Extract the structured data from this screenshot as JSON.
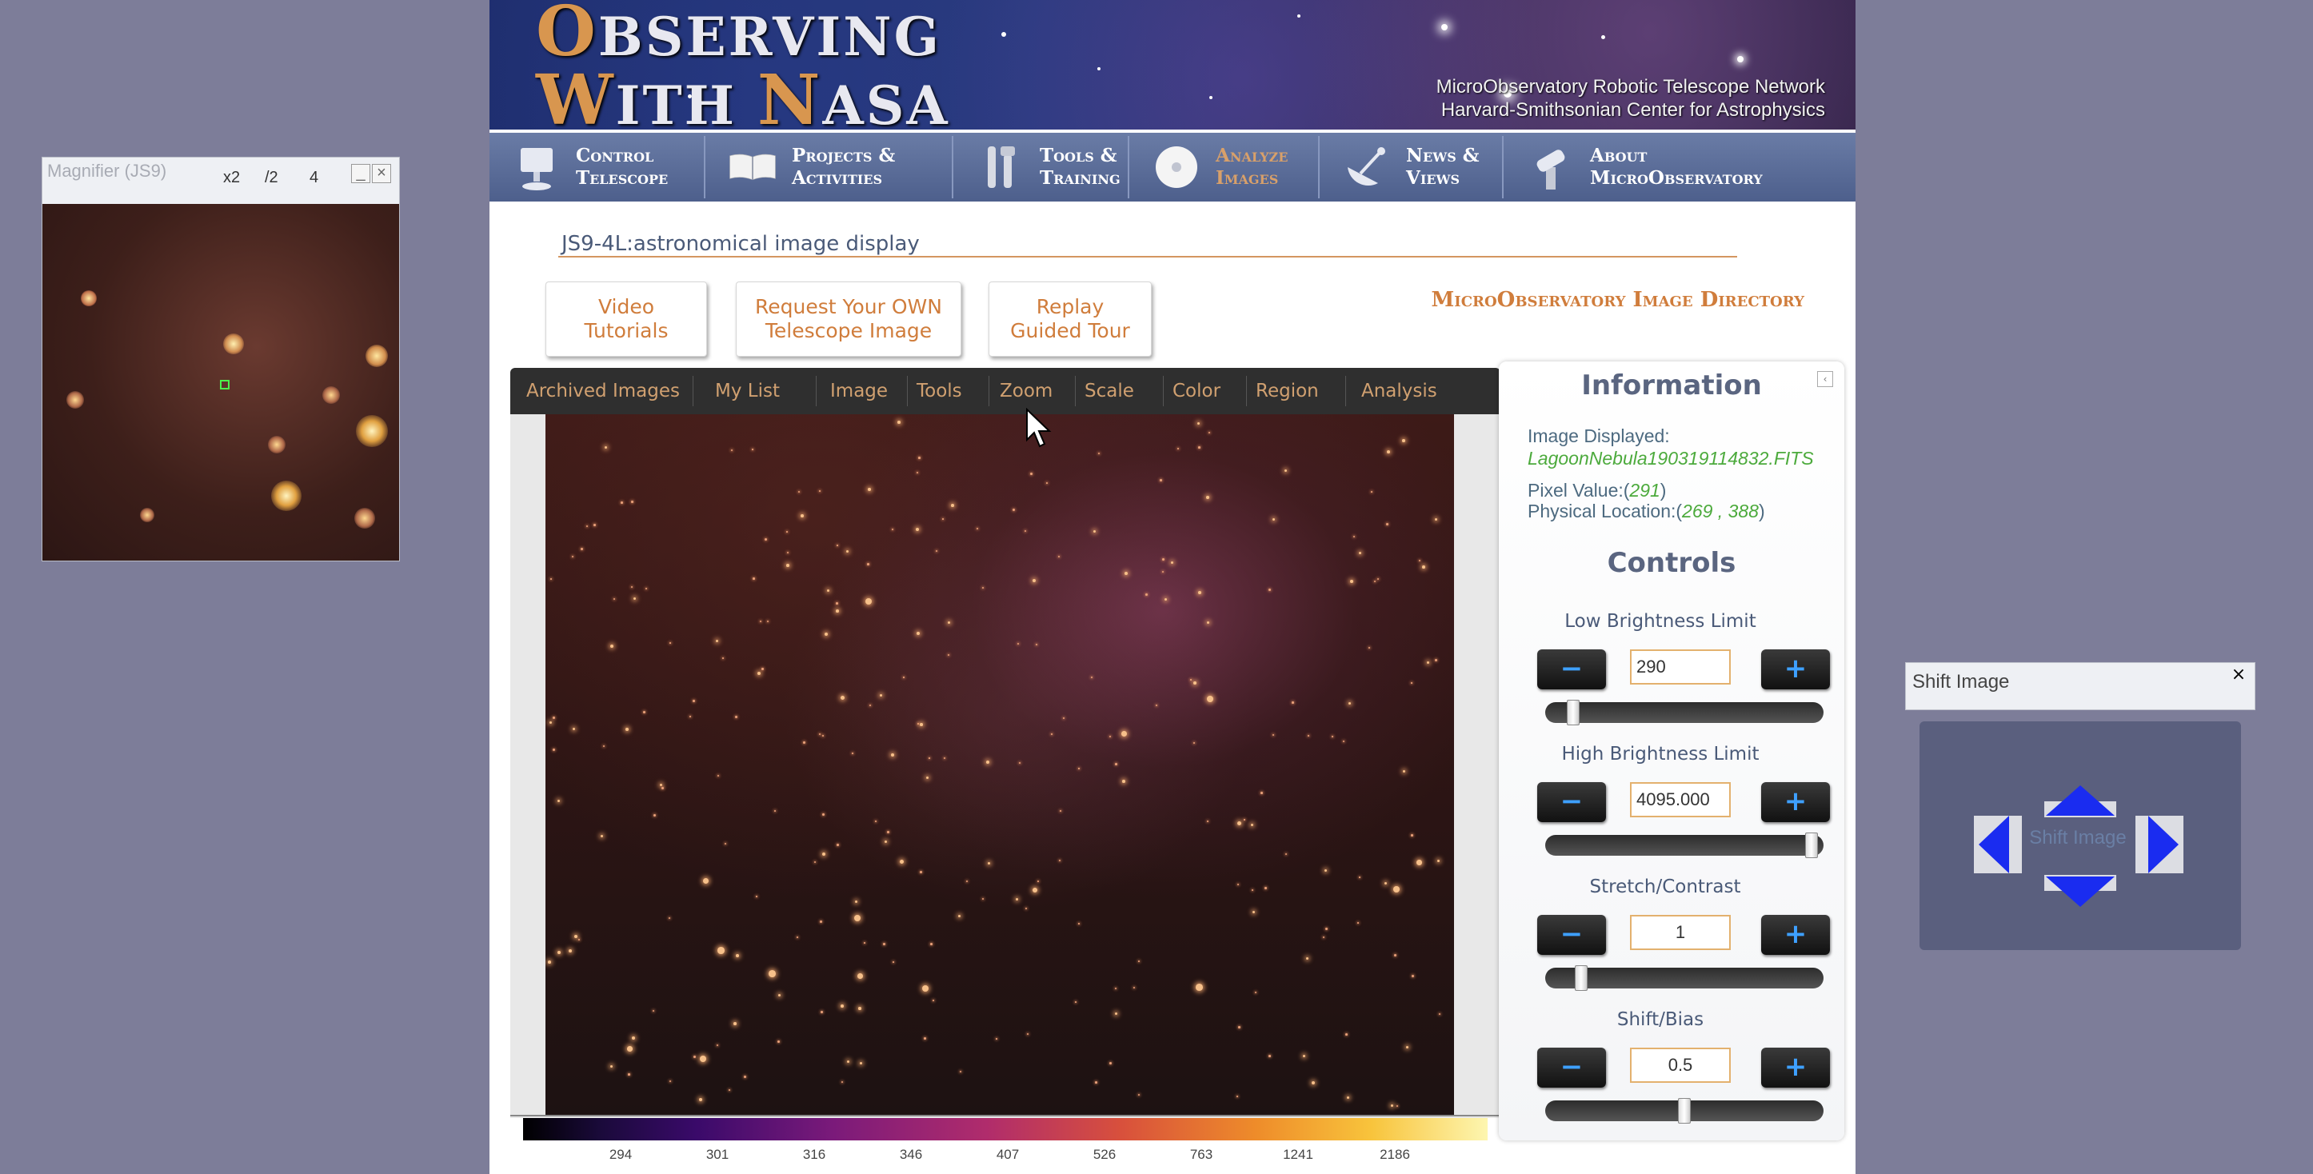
{
  "magnifier": {
    "title": "Magnifier (JS9)",
    "zoom_x2": "x2",
    "zoom_half": "/2",
    "zoom_4": "4",
    "minimize": "_",
    "close": "×"
  },
  "banner": {
    "title_line1_cap": "O",
    "title_line1_rest": "BSERVING",
    "title_line2_cap1": "W",
    "title_line2_rest1": "ITH ",
    "title_line2_cap2": "N",
    "title_line2_rest2": "ASA",
    "sub_line1": "MicroObservatory Robotic Telescope Network",
    "sub_line2": "Harvard-Smithsonian Center for Astrophysics"
  },
  "nav": {
    "items": [
      {
        "label": "Control\nTelescope",
        "icon": "telescope-icon"
      },
      {
        "label": "Projects &\nActivities",
        "icon": "book-icon"
      },
      {
        "label": "Tools &\nTraining",
        "icon": "tools-icon"
      },
      {
        "label": "Analyze\nImages",
        "icon": "disc-icon"
      },
      {
        "label": "News &\nViews",
        "icon": "satellite-dish-icon"
      },
      {
        "label": "About\nMicroObservatory",
        "icon": "observatory-icon"
      }
    ],
    "active_index": 3
  },
  "page": {
    "subtitle": "JS9-4L:astronomical image display",
    "buttons": {
      "video": "Video\nTutorials",
      "request": "Request Your OWN\nTelescope Image",
      "replay": "Replay\nGuided Tour"
    },
    "directory_link": "MicroObservatory Image Directory"
  },
  "js9": {
    "menu": [
      "Archived Images",
      "My List",
      "Image",
      "Tools",
      "Zoom",
      "Scale",
      "Color",
      "Region",
      "Analysis"
    ],
    "colorbar_ticks": [
      "294",
      "301",
      "316",
      "346",
      "407",
      "526",
      "763",
      "1241",
      "2186"
    ]
  },
  "info": {
    "title": "Information",
    "image_label": "Image Displayed:",
    "image_value": "LagoonNebula190319114832.FITS",
    "pixel_label": "Pixel Value:(",
    "pixel_value": "291",
    "pixel_close": ")",
    "location_label": "Physical Location:(",
    "location_value": "269 , 388",
    "location_close": ")"
  },
  "controls": {
    "title": "Controls",
    "low": {
      "label": "Low Brightness Limit",
      "value": "290",
      "position": 0.08
    },
    "high": {
      "label": "High Brightness Limit",
      "value": "4095.000",
      "position": 0.98
    },
    "stretch": {
      "label": "Stretch/Contrast",
      "value": "1",
      "position": 0.11
    },
    "bias": {
      "label": "Shift/Bias",
      "value": "0.5",
      "position": 0.5
    },
    "minus": "−",
    "plus": "+"
  },
  "shift": {
    "title": "Shift Image",
    "close": "×",
    "center_label": "Shift Image"
  },
  "colors": {
    "accent_orange": "#d07d3c",
    "nav_bg": "#5a6c98",
    "arrow_blue": "#1a2cf0",
    "info_green": "#4caa3c"
  }
}
